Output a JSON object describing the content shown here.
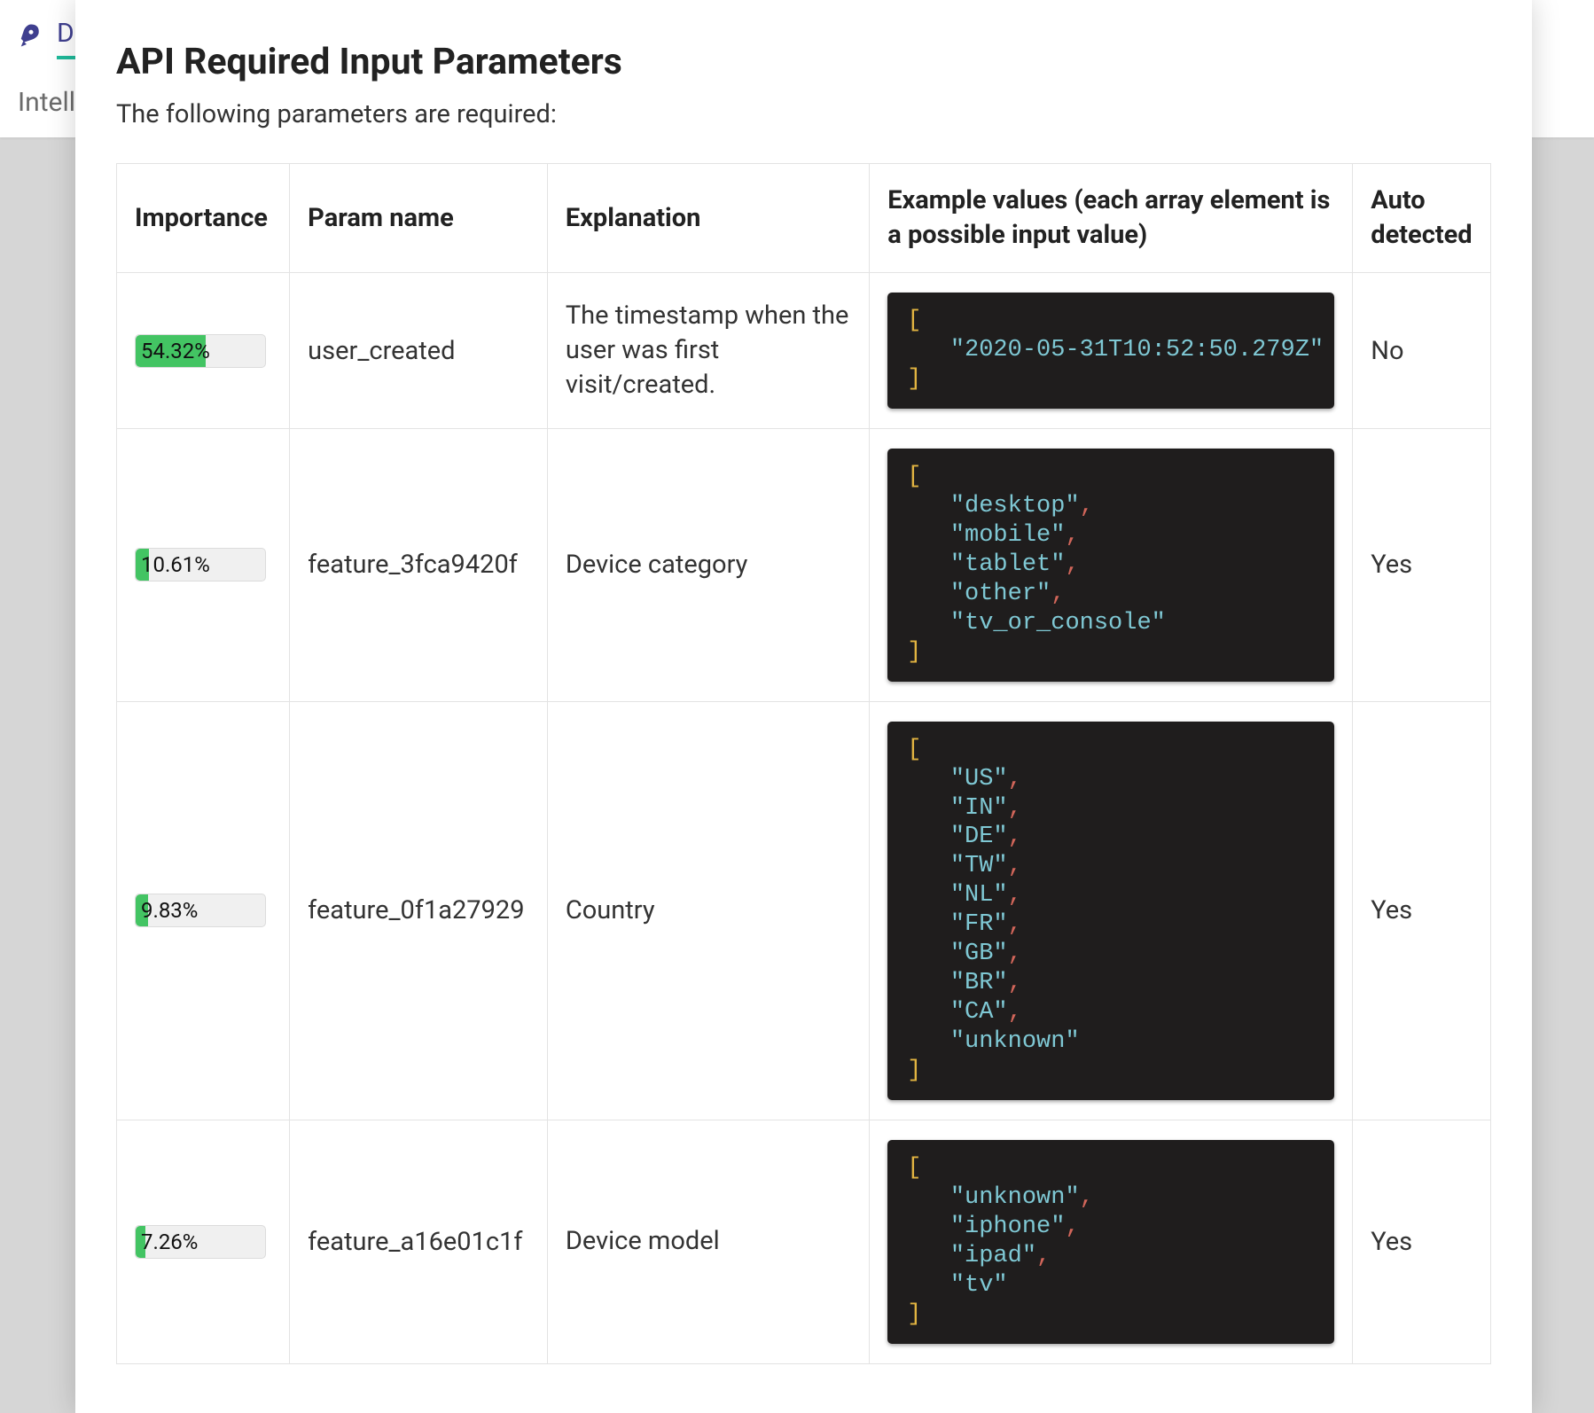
{
  "background": {
    "tab_label": "De",
    "subtitle": "Intelli"
  },
  "modal": {
    "title": "API Required Input Parameters",
    "subtitle": "The following parameters are required:"
  },
  "table": {
    "headers": {
      "importance": "Importance",
      "param_name": "Param name",
      "explanation": "Explanation",
      "example": "Example values (each array element is a possible input value)",
      "auto_detected": "Auto detected"
    },
    "auto_values": {
      "yes": "Yes",
      "no": "No"
    },
    "rows": [
      {
        "importance_percent": 54.32,
        "importance_label": "54.32%",
        "param_name": "user_created",
        "explanation": "The timestamp when the user was first visit/created.",
        "example_values": [
          "2020-05-31T10:52:50.279Z"
        ],
        "auto_detected": false
      },
      {
        "importance_percent": 10.61,
        "importance_label": "10.61%",
        "param_name": "feature_3fca9420f",
        "explanation": "Device category",
        "example_values": [
          "desktop",
          "mobile",
          "tablet",
          "other",
          "tv_or_console"
        ],
        "auto_detected": true
      },
      {
        "importance_percent": 9.83,
        "importance_label": "9.83%",
        "param_name": "feature_0f1a27929",
        "explanation": "Country",
        "example_values": [
          "US",
          "IN",
          "DE",
          "TW",
          "NL",
          "FR",
          "GB",
          "BR",
          "CA",
          "unknown"
        ],
        "auto_detected": true
      },
      {
        "importance_percent": 7.26,
        "importance_label": "7.26%",
        "param_name": "feature_a16e01c1f",
        "explanation": "Device model",
        "example_values": [
          "unknown",
          "iphone",
          "ipad",
          "tv"
        ],
        "auto_detected": true
      }
    ]
  }
}
